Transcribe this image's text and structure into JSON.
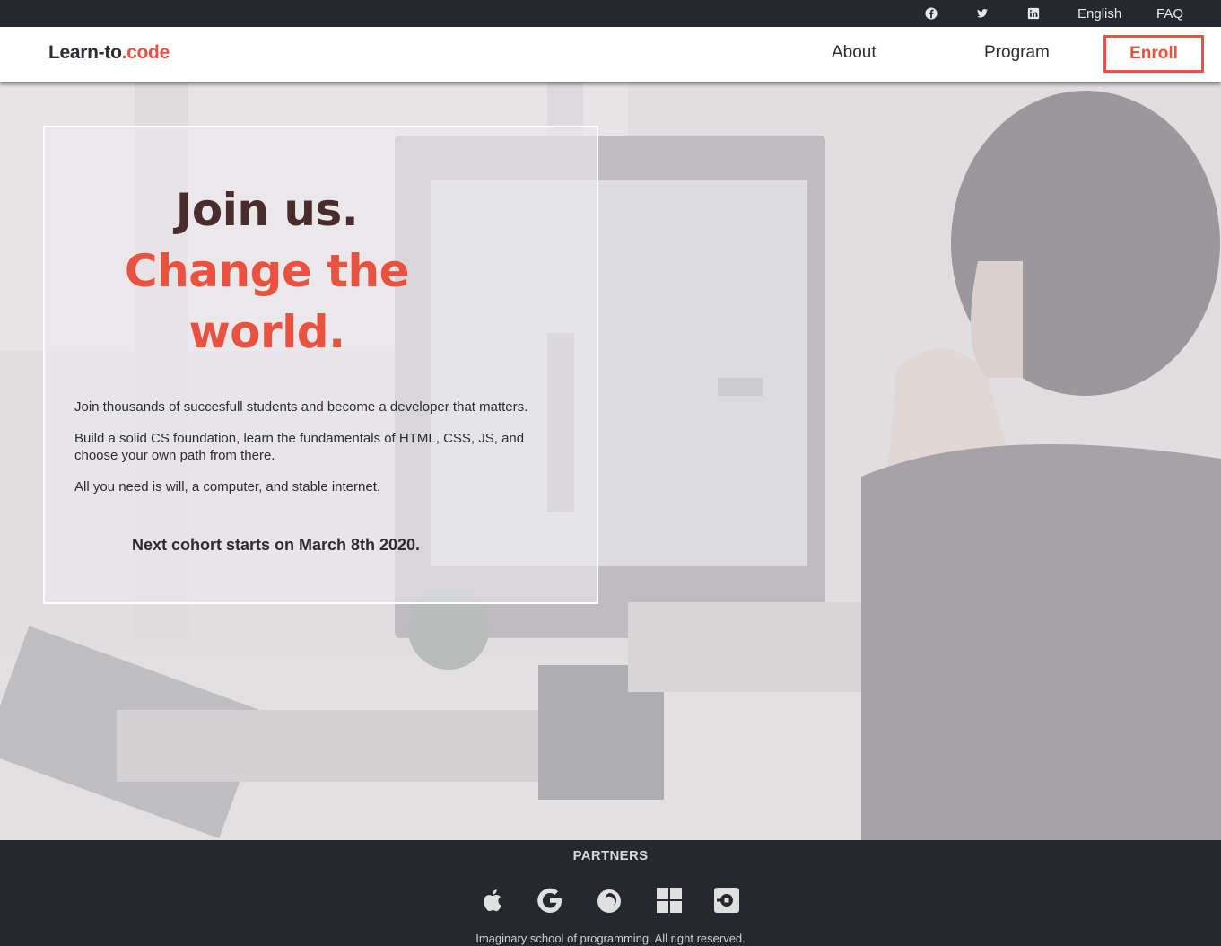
{
  "topbar": {
    "social": [
      {
        "icon": "facebook-icon"
      },
      {
        "icon": "twitter-icon"
      },
      {
        "icon": "linkedin-icon"
      }
    ],
    "language": "English",
    "faq": "FAQ"
  },
  "navbar": {
    "logo_main": "Learn-to",
    "logo_accent": ".code",
    "about": "About",
    "program": "Program",
    "enroll": "Enroll"
  },
  "hero": {
    "headline_line1": "Join us.",
    "headline_line2": "Change the",
    "headline_line3": "world.",
    "paragraph1": "Join thousands of succesfull students and become a developer that matters.",
    "paragraph2": "Build a solid CS foundation, learn the fundamentals of HTML, CSS, JS, and choose your own path from there.",
    "paragraph3": "All you need is will, a computer, and stable internet.",
    "cohort": "Next cohort starts on March 8th 2020."
  },
  "footer": {
    "partners_title": "PARTNERS",
    "partners": [
      {
        "icon": "apple-icon"
      },
      {
        "icon": "google-icon"
      },
      {
        "icon": "firefox-icon"
      },
      {
        "icon": "windows-icon"
      },
      {
        "icon": "uber-icon"
      }
    ],
    "copyright": "Imaginary school of programming. All right reserved."
  },
  "colors": {
    "accent": "#e8523f",
    "dark": "#262830",
    "headline_dark": "#4a2c2c"
  }
}
